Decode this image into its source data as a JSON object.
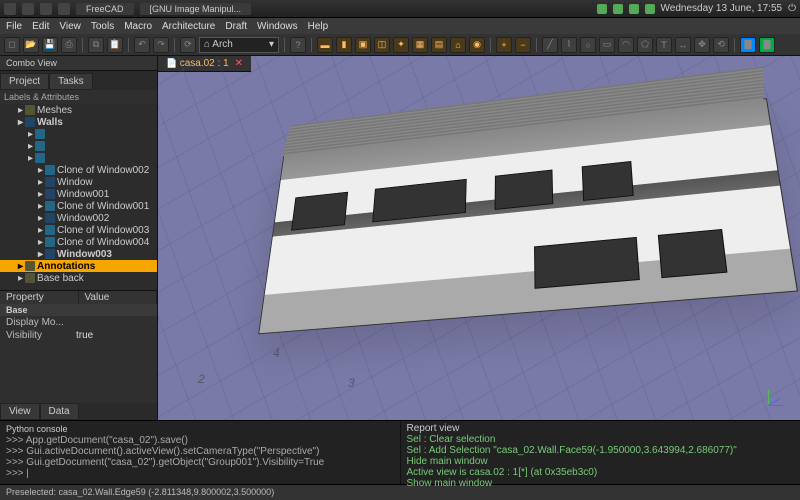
{
  "systray": {
    "app_tabs": [
      "FreeCAD",
      "[GNU Image Manipul..."
    ],
    "clock": "Wednesday 13 June, 17:55"
  },
  "menubar": [
    "File",
    "Edit",
    "View",
    "Tools",
    "Macro",
    "Architecture",
    "Draft",
    "Windows",
    "Help"
  ],
  "workbench": "Arch",
  "combo": {
    "title": "Combo View",
    "tabs": [
      "Project",
      "Tasks"
    ],
    "subhead": "Labels & Attributes",
    "tree": [
      {
        "label": "Meshes",
        "ind": 1,
        "ic": "m"
      },
      {
        "label": "Walls",
        "ind": 1,
        "ic": "w",
        "bold": true
      },
      {
        "label": "",
        "ind": 2,
        "ic": "c"
      },
      {
        "label": "",
        "ind": 2,
        "ic": "c"
      },
      {
        "label": "",
        "ind": 2,
        "ic": "c"
      },
      {
        "label": "Clone of Window002",
        "ind": 3,
        "ic": "c"
      },
      {
        "label": "Window",
        "ind": 3,
        "ic": "w"
      },
      {
        "label": "Window001",
        "ind": 3,
        "ic": "w"
      },
      {
        "label": "Clone of Window001",
        "ind": 3,
        "ic": "c"
      },
      {
        "label": "Window002",
        "ind": 3,
        "ic": "w"
      },
      {
        "label": "Clone of Window003",
        "ind": 3,
        "ic": "c"
      },
      {
        "label": "Clone of Window004",
        "ind": 3,
        "ic": "c"
      },
      {
        "label": "Window003",
        "ind": 3,
        "ic": "w",
        "bold": true
      },
      {
        "label": "Annotations",
        "ind": 1,
        "ic": "m",
        "sel": true
      },
      {
        "label": "Base back",
        "ind": 1,
        "ic": "m"
      }
    ],
    "prop_head": [
      "Property",
      "Value"
    ],
    "prop_base": "Base",
    "props": [
      {
        "k": "Display Mo...",
        "v": ""
      },
      {
        "k": "Visibility",
        "v": "true"
      }
    ],
    "lower_tabs": [
      "View",
      "Data"
    ]
  },
  "viewport": {
    "doc_tab": "casa.02 : 1",
    "nums": [
      "2",
      "3",
      "4"
    ]
  },
  "console": {
    "title": "Python console",
    "lines": [
      ">>> App.getDocument(\"casa_02\").save()",
      ">>> Gui.activeDocument().activeView().setCameraType(\"Perspective\")",
      ">>> Gui.getDocument(\"casa_02\").getObject(\"Group001\").Visibility=True",
      ">>> |"
    ]
  },
  "report": {
    "title": "Report view",
    "lines": [
      "Sel : Clear selection",
      "Sel : Add Selection \"casa_02.Wall.Face59(-1.950000,3.643994,2.686077)\"",
      "Hide main window",
      "Active view is casa.02 : 1[*] (at 0x35eb3c0)",
      "Show main window"
    ]
  },
  "statusbar": "Preselected: casa_02.Wall.Edge59 (-2.811348,9.800002,3.500000)"
}
